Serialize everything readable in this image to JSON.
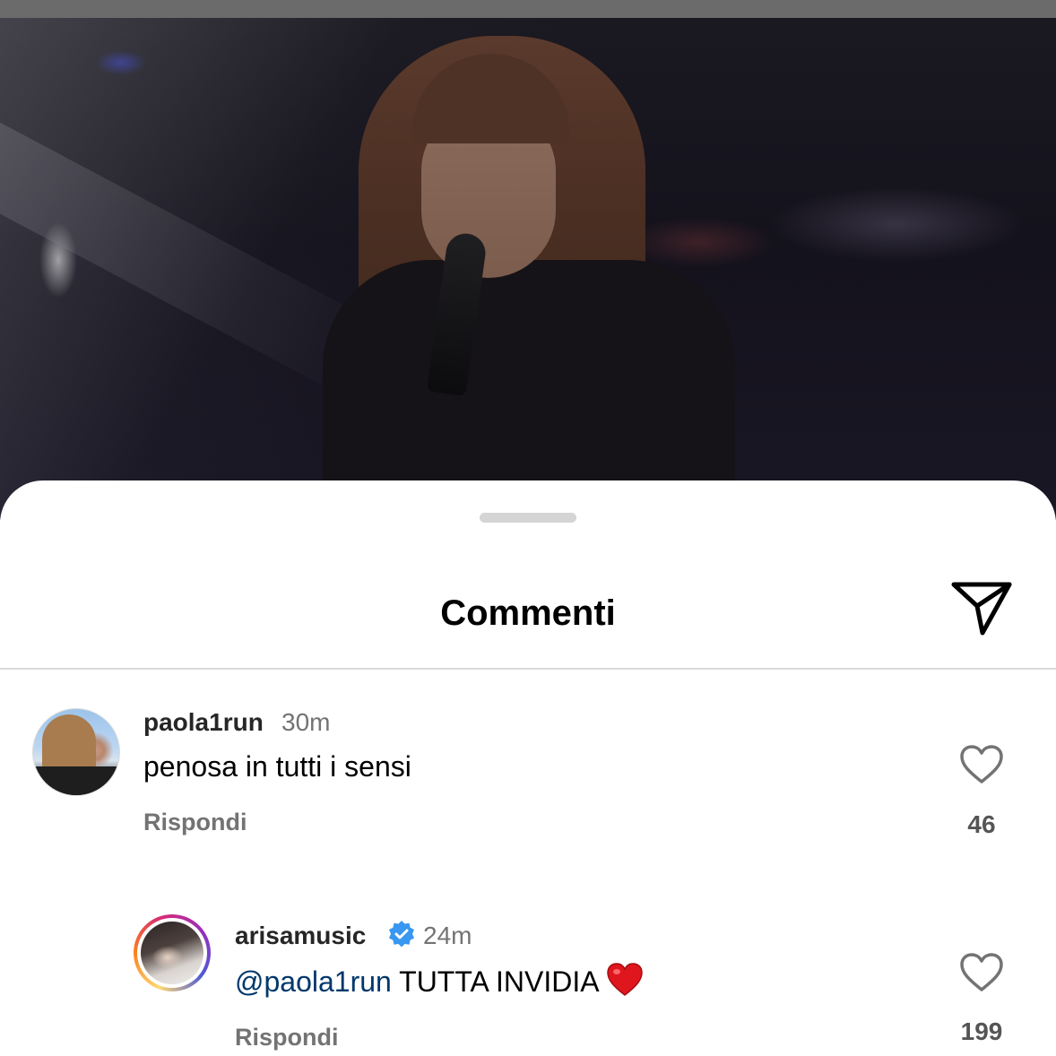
{
  "sheet": {
    "title": "Commenti",
    "share_icon": "paper-plane-icon"
  },
  "comments": [
    {
      "username": "paola1run",
      "time": "30m",
      "text": "penosa in tutti i sensi",
      "reply_label": "Rispondi",
      "likes": "46",
      "like_icon": "heart-outline-icon"
    },
    {
      "username": "arisamusic",
      "verified": true,
      "verified_icon": "verified-badge-icon",
      "time": "24m",
      "mention": "@paola1run",
      "text": "TUTTA INVIDIA",
      "emoji": "red-heart-emoji",
      "reply_label": "Rispondi",
      "likes": "199",
      "like_icon": "heart-outline-icon"
    }
  ],
  "colors": {
    "mention": "#00376b",
    "verified": "#3897f0",
    "secondary_text": "#737373",
    "divider": "#dbdbdb"
  }
}
